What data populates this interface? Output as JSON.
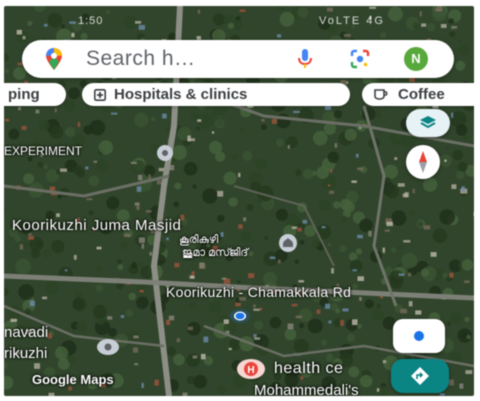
{
  "status_bar": {
    "time": "1:50",
    "icons": "VoLTE 4G"
  },
  "search": {
    "placeholder": "Search h…",
    "avatar_letter": "N"
  },
  "chips": [
    {
      "label": "ping",
      "icon": "shopping-icon"
    },
    {
      "label": "Hospitals & clinics",
      "icon": "hospital-icon"
    },
    {
      "label": "Coffee",
      "icon": "coffee-icon"
    }
  ],
  "map_labels": {
    "experiment": "EXPERIMENT",
    "masjid": "Koorikuzhi Juma Masjid",
    "masjid_local_1": "കൂരികുഴി",
    "masjid_local_2": "ജുമാ മസ്ജിദ്",
    "road": "Koorikuzhi - Chamakkala Rd",
    "vadi": "navadi",
    "ikuzhi": "rikuzhi",
    "health": "health ce",
    "mohammed": "Mohammedali's"
  },
  "attribution": "Google Maps",
  "colors": {
    "accent_blue": "#1a73e8",
    "directions_teal": "#0b8484",
    "avatar_green": "#57a93b",
    "hospital_red": "#e8453c"
  }
}
